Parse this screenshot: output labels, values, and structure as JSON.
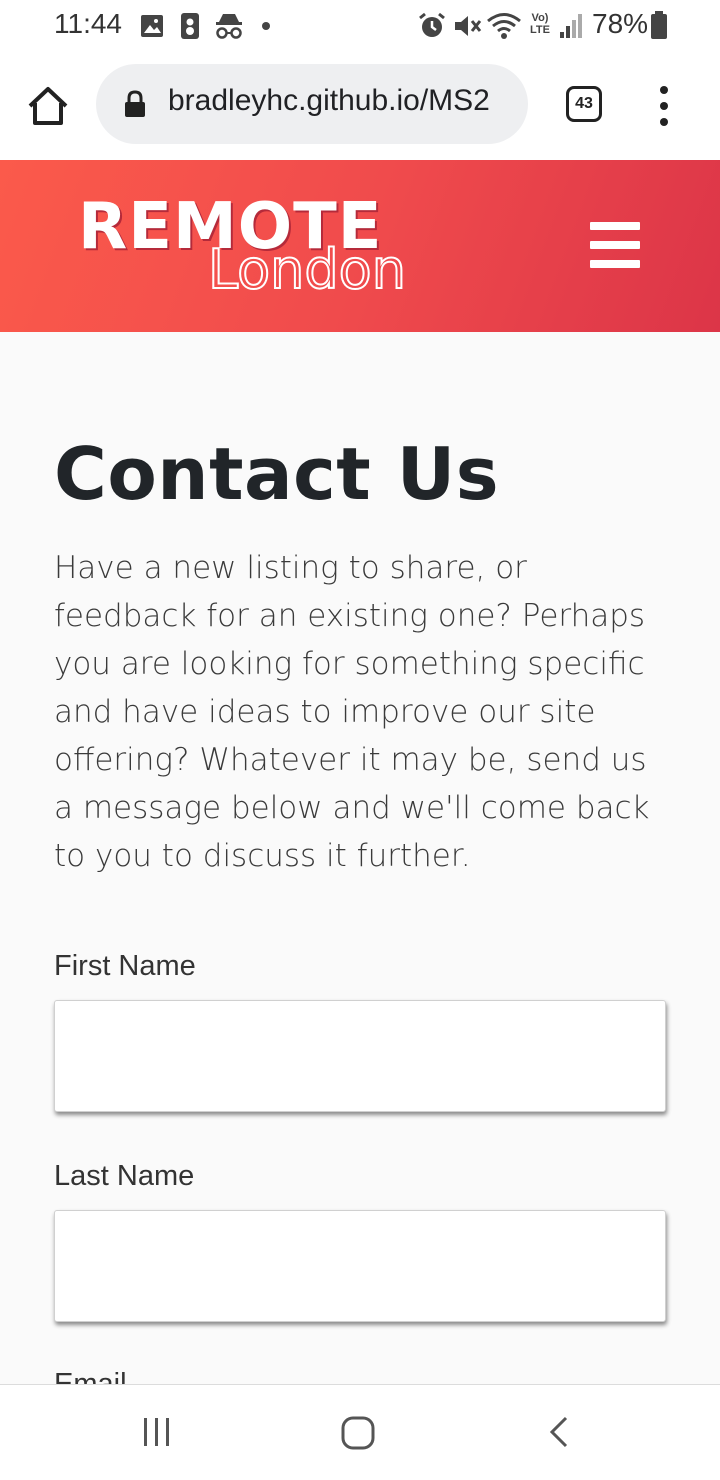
{
  "status_bar": {
    "time": "11:44",
    "battery": "78%",
    "network_label": "Vo) LTE"
  },
  "browser": {
    "url": "bradleyhc.github.io/MS2",
    "tab_count": "43"
  },
  "header": {
    "logo_line1": "REMOTE",
    "logo_line2": "London",
    "brand_gradient": [
      "#fb5a4b",
      "#dc3548"
    ]
  },
  "main": {
    "title": "Contact Us",
    "intro": "Have a new listing to share, or feedback for an existing one? Perhaps you are looking for something specific and have ideas to improve our site offering? Whatever it may be, send us a message below and we'll come back to you to discuss it further.",
    "form": {
      "first_name_label": "First Name",
      "first_name_value": "",
      "last_name_label": "Last Name",
      "last_name_value": "",
      "email_label": "Email"
    }
  },
  "icons": [
    "gallery-icon",
    "sim-icon",
    "incognito-icon",
    "alarm-icon",
    "mute-icon",
    "wifi-icon",
    "signal-icon",
    "battery-icon",
    "home-icon",
    "lock-icon",
    "kebab-menu-icon",
    "hamburger-icon",
    "recents-icon",
    "home-circle-icon",
    "back-icon"
  ]
}
